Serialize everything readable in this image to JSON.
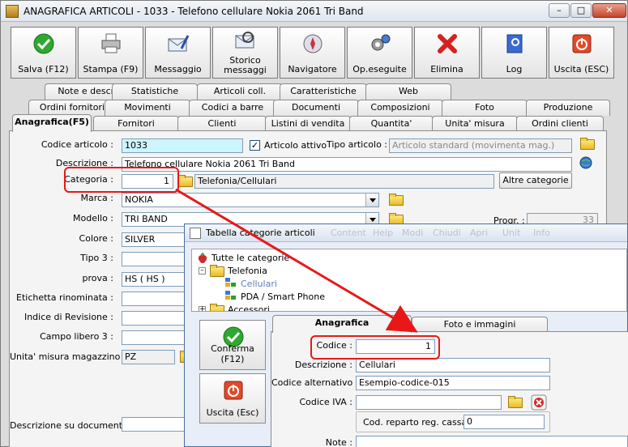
{
  "window": {
    "title": "ANAGRAFICA ARTICOLI - 1033 - Telefono cellulare Nokia 2061 Tri Band"
  },
  "toolbar": {
    "buttons": [
      {
        "label": "Salva (F12)",
        "icon": "check-icon"
      },
      {
        "label": "Stampa (F9)",
        "icon": "printer-icon"
      },
      {
        "label": "Messaggio",
        "icon": "envelope-pen-icon"
      },
      {
        "label": "Storico\nmessaggi",
        "icon": "envelope-search-icon"
      },
      {
        "label": "Navigatore",
        "icon": "compass-icon"
      },
      {
        "label": "Op.eseguite",
        "icon": "gears-icon"
      },
      {
        "label": "Elimina",
        "icon": "red-x-icon"
      },
      {
        "label": "Log",
        "icon": "log-book-icon"
      },
      {
        "label": "Uscita (ESC)",
        "icon": "power-icon"
      }
    ]
  },
  "tabs": {
    "row1": [
      "Note e descr.",
      "Statistiche",
      "Articoli coll.",
      "Caratteristiche",
      "Web"
    ],
    "row2": [
      "Ordini fornitori",
      "Movimenti",
      "Codici a barre",
      "Documenti",
      "Composizioni",
      "Foto",
      "Produzione"
    ],
    "row3": [
      "Anagrafica(F5)",
      "Fornitori",
      "Clienti",
      "Listini di vendita",
      "Quantita'",
      "Unita' misura",
      "Ordini clienti"
    ]
  },
  "form": {
    "codice_label": "Codice articolo :",
    "codice_value": "1033",
    "attivo_label": "Articolo attivo",
    "attivo_checked": "✓",
    "tipo_label": "Tipo articolo :",
    "tipo_value": "Articolo standard (movimenta mag.)",
    "descrizione_label": "Descrizione :",
    "descrizione_value": "Telefono cellulare Nokia 2061 Tri Band",
    "categoria_label": "Categoria :",
    "categoria_value": "1",
    "categoria_desc": "Telefonia/Cellulari",
    "altre_categorie": "Altre categorie",
    "marca_label": "Marca :",
    "marca_value": "NOKIA",
    "modello_label": "Modello :",
    "modello_value": "TRI BAND",
    "progr_label": "Progr. :",
    "progr_value": "33",
    "colore_label": "Colore :",
    "colore_value": "SILVER",
    "tipo3_label": "Tipo 3 :",
    "prova_label": "prova :",
    "prova_value": "HS ( HS )",
    "etichetta_label": "Etichetta rinominata :",
    "indice_label": "Indice di Revisione :",
    "campo_label": "Campo libero 3 :",
    "unita_label": "Unita' misura magazzino :",
    "unita_value": "PZ",
    "descdoc_label": "Descrizione su documenti :"
  },
  "dialog": {
    "title": "Tabella categorie articoli",
    "ghost_items": [
      "Content",
      "Help",
      "Modi",
      "Chiudi",
      "Apri",
      "Unit",
      "Info"
    ],
    "tree": [
      {
        "label": "Tutte le categorie"
      },
      {
        "label": "Telefonia"
      },
      {
        "label": "Cellulari"
      },
      {
        "label": "PDA / Smart Phone"
      },
      {
        "label": "Accessori"
      }
    ],
    "conferma": "Conferma (F12)",
    "uscita": "Uscita (Esc)",
    "tab_anagrafica": "Anagrafica",
    "tab_foto": "Foto e immagini",
    "codice_label": "Codice :",
    "codice_value": "1",
    "descrizione_label": "Descrizione :",
    "descrizione_value": "Cellulari",
    "codalt_label": "Codice alternativo :",
    "codalt_value": "Esempio-codice-015",
    "iva_label": "Codice IVA :",
    "reparto_label": "Cod. reparto reg. cassa :",
    "reparto_value": "0",
    "note_label": "Note :"
  },
  "colors": {
    "highlight": "#e81818",
    "cyan_field": "#ccf5ff"
  }
}
